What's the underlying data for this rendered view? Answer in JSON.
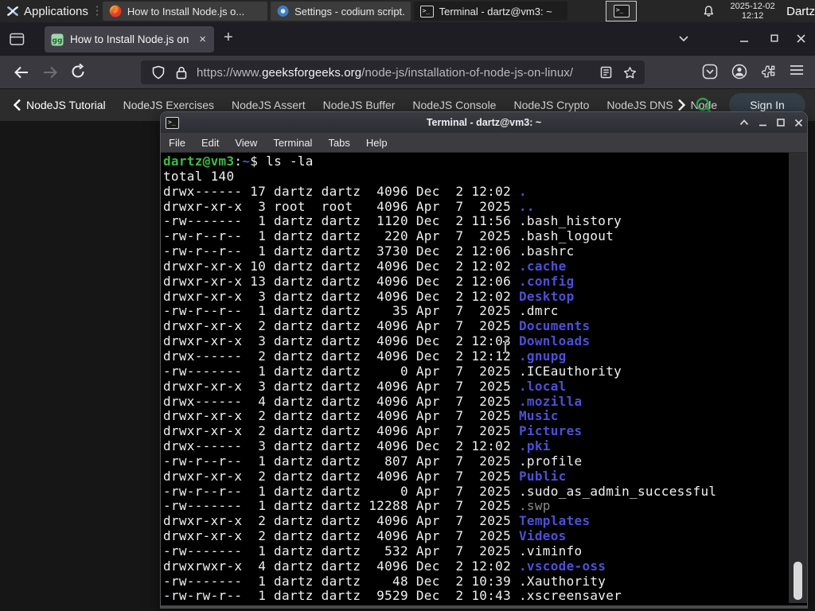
{
  "panel": {
    "applications_label": "Applications",
    "windows": [
      {
        "title": "How to Install Node.js o...",
        "icon": "firefox"
      },
      {
        "title": "Settings - codium script...",
        "icon": "codium"
      },
      {
        "title": "Terminal - dartz@vm3: ~",
        "icon": "terminal",
        "active": true
      }
    ],
    "clock_date": "2025-12-02",
    "clock_time": "12:12",
    "user": "Dartz"
  },
  "browser": {
    "tab_title": "How to Install Node.js on",
    "close_glyph": "×",
    "new_tab_glyph": "+",
    "url": {
      "scheme": "https://www.",
      "domain": "geeksforgeeks.org",
      "path": "/node-js/installation-of-node-js-on-linux/"
    }
  },
  "site_nav": {
    "links": [
      "NodeJS Tutorial",
      "NodeJS Exercises",
      "NodeJS Assert",
      "NodeJS Buffer",
      "NodeJS Console",
      "NodeJS Crypto",
      "NodeJS DNS",
      "Node"
    ],
    "sign_in": "Sign In"
  },
  "terminal": {
    "title": "Terminal - dartz@vm3: ~",
    "menu": [
      "File",
      "Edit",
      "View",
      "Terminal",
      "Tabs",
      "Help"
    ],
    "prompt": {
      "user_host": "dartz@vm3",
      "separator": ":",
      "cwd": "~",
      "command": "$ ls -la"
    },
    "total": "total 140",
    "entries": [
      {
        "perms": "drwx------",
        "links": 17,
        "owner": "dartz",
        "group": "dartz",
        "size": 4096,
        "month": "Dec",
        "day": 2,
        "time": "12:02",
        "name": ".",
        "kind": "dir"
      },
      {
        "perms": "drwxr-xr-x",
        "links": 3,
        "owner": "root",
        "group": "root",
        "size": 4096,
        "month": "Apr",
        "day": 7,
        "time": "2025",
        "name": "..",
        "kind": "dir"
      },
      {
        "perms": "-rw-------",
        "links": 1,
        "owner": "dartz",
        "group": "dartz",
        "size": 1120,
        "month": "Dec",
        "day": 2,
        "time": "11:56",
        "name": ".bash_history",
        "kind": "file"
      },
      {
        "perms": "-rw-r--r--",
        "links": 1,
        "owner": "dartz",
        "group": "dartz",
        "size": 220,
        "month": "Apr",
        "day": 7,
        "time": "2025",
        "name": ".bash_logout",
        "kind": "file"
      },
      {
        "perms": "-rw-r--r--",
        "links": 1,
        "owner": "dartz",
        "group": "dartz",
        "size": 3730,
        "month": "Dec",
        "day": 2,
        "time": "12:06",
        "name": ".bashrc",
        "kind": "file"
      },
      {
        "perms": "drwxr-xr-x",
        "links": 10,
        "owner": "dartz",
        "group": "dartz",
        "size": 4096,
        "month": "Dec",
        "day": 2,
        "time": "12:02",
        "name": ".cache",
        "kind": "dir"
      },
      {
        "perms": "drwxr-xr-x",
        "links": 13,
        "owner": "dartz",
        "group": "dartz",
        "size": 4096,
        "month": "Dec",
        "day": 2,
        "time": "12:06",
        "name": ".config",
        "kind": "dir"
      },
      {
        "perms": "drwxr-xr-x",
        "links": 3,
        "owner": "dartz",
        "group": "dartz",
        "size": 4096,
        "month": "Dec",
        "day": 2,
        "time": "12:02",
        "name": "Desktop",
        "kind": "dir"
      },
      {
        "perms": "-rw-r--r--",
        "links": 1,
        "owner": "dartz",
        "group": "dartz",
        "size": 35,
        "month": "Apr",
        "day": 7,
        "time": "2025",
        "name": ".dmrc",
        "kind": "file"
      },
      {
        "perms": "drwxr-xr-x",
        "links": 2,
        "owner": "dartz",
        "group": "dartz",
        "size": 4096,
        "month": "Apr",
        "day": 7,
        "time": "2025",
        "name": "Documents",
        "kind": "dir"
      },
      {
        "perms": "drwxr-xr-x",
        "links": 3,
        "owner": "dartz",
        "group": "dartz",
        "size": 4096,
        "month": "Dec",
        "day": 2,
        "time": "12:03",
        "name": "Downloads",
        "kind": "dir"
      },
      {
        "perms": "drwx------",
        "links": 2,
        "owner": "dartz",
        "group": "dartz",
        "size": 4096,
        "month": "Dec",
        "day": 2,
        "time": "12:12",
        "name": ".gnupg",
        "kind": "dir"
      },
      {
        "perms": "-rw-------",
        "links": 1,
        "owner": "dartz",
        "group": "dartz",
        "size": 0,
        "month": "Apr",
        "day": 7,
        "time": "2025",
        "name": ".ICEauthority",
        "kind": "file"
      },
      {
        "perms": "drwxr-xr-x",
        "links": 3,
        "owner": "dartz",
        "group": "dartz",
        "size": 4096,
        "month": "Apr",
        "day": 7,
        "time": "2025",
        "name": ".local",
        "kind": "dir"
      },
      {
        "perms": "drwx------",
        "links": 4,
        "owner": "dartz",
        "group": "dartz",
        "size": 4096,
        "month": "Apr",
        "day": 7,
        "time": "2025",
        "name": ".mozilla",
        "kind": "dir"
      },
      {
        "perms": "drwxr-xr-x",
        "links": 2,
        "owner": "dartz",
        "group": "dartz",
        "size": 4096,
        "month": "Apr",
        "day": 7,
        "time": "2025",
        "name": "Music",
        "kind": "dir"
      },
      {
        "perms": "drwxr-xr-x",
        "links": 2,
        "owner": "dartz",
        "group": "dartz",
        "size": 4096,
        "month": "Apr",
        "day": 7,
        "time": "2025",
        "name": "Pictures",
        "kind": "dir"
      },
      {
        "perms": "drwx------",
        "links": 3,
        "owner": "dartz",
        "group": "dartz",
        "size": 4096,
        "month": "Dec",
        "day": 2,
        "time": "12:02",
        "name": ".pki",
        "kind": "dir"
      },
      {
        "perms": "-rw-r--r--",
        "links": 1,
        "owner": "dartz",
        "group": "dartz",
        "size": 807,
        "month": "Apr",
        "day": 7,
        "time": "2025",
        "name": ".profile",
        "kind": "file"
      },
      {
        "perms": "drwxr-xr-x",
        "links": 2,
        "owner": "dartz",
        "group": "dartz",
        "size": 4096,
        "month": "Apr",
        "day": 7,
        "time": "2025",
        "name": "Public",
        "kind": "dir"
      },
      {
        "perms": "-rw-r--r--",
        "links": 1,
        "owner": "dartz",
        "group": "dartz",
        "size": 0,
        "month": "Apr",
        "day": 7,
        "time": "2025",
        "name": ".sudo_as_admin_successful",
        "kind": "file"
      },
      {
        "perms": "-rw-------",
        "links": 1,
        "owner": "dartz",
        "group": "dartz",
        "size": 12288,
        "month": "Apr",
        "day": 7,
        "time": "2025",
        "name": ".swp",
        "kind": "dim"
      },
      {
        "perms": "drwxr-xr-x",
        "links": 2,
        "owner": "dartz",
        "group": "dartz",
        "size": 4096,
        "month": "Apr",
        "day": 7,
        "time": "2025",
        "name": "Templates",
        "kind": "dir"
      },
      {
        "perms": "drwxr-xr-x",
        "links": 2,
        "owner": "dartz",
        "group": "dartz",
        "size": 4096,
        "month": "Apr",
        "day": 7,
        "time": "2025",
        "name": "Videos",
        "kind": "dir"
      },
      {
        "perms": "-rw-------",
        "links": 1,
        "owner": "dartz",
        "group": "dartz",
        "size": 532,
        "month": "Apr",
        "day": 7,
        "time": "2025",
        "name": ".viminfo",
        "kind": "file"
      },
      {
        "perms": "drwxrwxr-x",
        "links": 4,
        "owner": "dartz",
        "group": "dartz",
        "size": 4096,
        "month": "Dec",
        "day": 2,
        "time": "12:02",
        "name": ".vscode-oss",
        "kind": "dir"
      },
      {
        "perms": "-rw-------",
        "links": 1,
        "owner": "dartz",
        "group": "dartz",
        "size": 48,
        "month": "Dec",
        "day": 2,
        "time": "10:39",
        "name": ".Xauthority",
        "kind": "file"
      },
      {
        "perms": "-rw-rw-r--",
        "links": 1,
        "owner": "dartz",
        "group": "dartz",
        "size": 9529,
        "month": "Dec",
        "day": 2,
        "time": "10:43",
        "name": ".xscreensaver",
        "kind": "file"
      }
    ]
  },
  "colors": {
    "term_green": "#3cbd3c",
    "term_blue": "#4b50d8",
    "accent_green": "#2f9e4f"
  }
}
